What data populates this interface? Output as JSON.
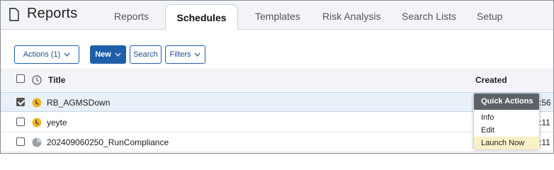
{
  "header": {
    "app_title": "Reports",
    "tabs": [
      {
        "label": "Reports"
      },
      {
        "label": "Schedules",
        "active": true
      },
      {
        "label": "Templates"
      },
      {
        "label": "Risk Analysis"
      },
      {
        "label": "Search Lists"
      },
      {
        "label": "Setup"
      }
    ]
  },
  "toolbar": {
    "actions_label": "Actions (1)",
    "new_label": "New",
    "search_label": "Search",
    "filters_label": "Filters"
  },
  "table": {
    "columns": {
      "title": "Title",
      "created": "Created"
    },
    "rows": [
      {
        "title": "RB_AGMSDown",
        "selected": true,
        "status": "running",
        "created_fragment": ":56"
      },
      {
        "title": "yeyte",
        "selected": false,
        "status": "running",
        "created_fragment": ":11"
      },
      {
        "title": "202409060250_RunCompliance",
        "selected": false,
        "status": "inactive",
        "created_fragment": ":11"
      }
    ]
  },
  "quick_actions": {
    "title": "Quick Actions",
    "items": [
      {
        "label": "Info"
      },
      {
        "label": "Edit"
      },
      {
        "label": "Launch Now",
        "highlighted": true
      }
    ]
  },
  "colors": {
    "accent": "#1f5fa8",
    "clock_active": "#f0b429",
    "clock_inactive": "#9aa0a6",
    "popup_header": "#5d6268",
    "highlight": "#fbf1c8"
  },
  "icons": {
    "app": "document-icon",
    "column_status": "clock-icon",
    "row_status": "clock-icon",
    "dropdown": "chevron-down-icon"
  }
}
